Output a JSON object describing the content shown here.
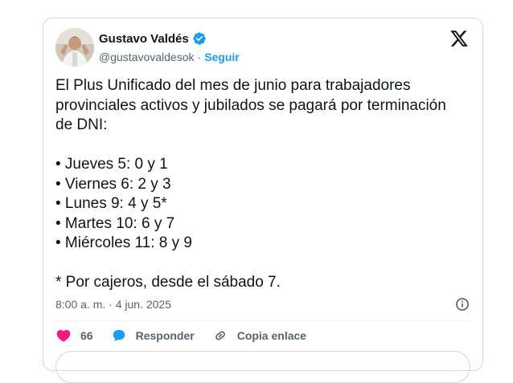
{
  "author": {
    "name": "Gustavo Valdés",
    "handle": "@gustavovaldesok",
    "separator": "·",
    "follow_label": "Seguir"
  },
  "icons": {
    "verified": "verified-badge-icon",
    "brand": "x-logo-icon",
    "info": "info-icon",
    "like": "heart-icon",
    "reply": "speech-bubble-icon",
    "copy": "link-icon"
  },
  "colors": {
    "accent": "#1d9bf0",
    "like": "#f91880",
    "text": "#0f1419",
    "muted": "#536471"
  },
  "tweet": {
    "lines": [
      "El Plus Unificado del mes de junio para trabajadores",
      "provinciales activos y jubilados se pagará por terminación",
      "de DNI:",
      "",
      "• Jueves 5: 0 y 1",
      "• Viernes 6: 2 y 3",
      "• Lunes 9: 4 y 5*",
      "• Martes 10: 6 y 7",
      "• Miércoles 11: 8 y 9",
      "",
      "* Por cajeros, desde el sábado 7."
    ],
    "timestamp": "8:00 a. m. · 4 jun. 2025"
  },
  "actions": {
    "likes": "66",
    "reply_label": "Responder",
    "copy_label": "Copia enlace"
  }
}
